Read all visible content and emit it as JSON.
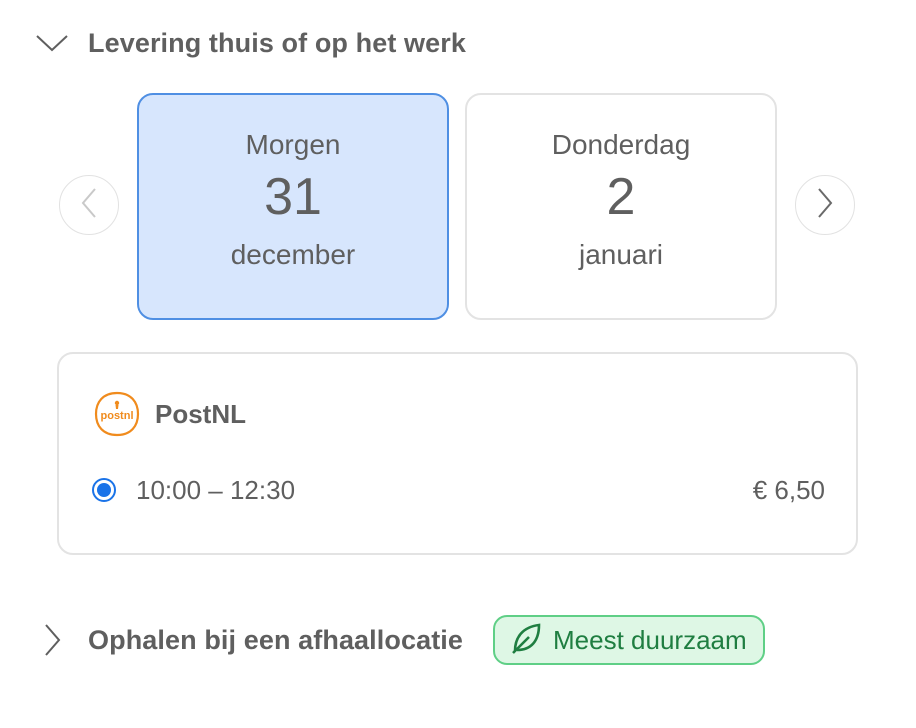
{
  "home_delivery": {
    "title": "Levering thuis of op het werk",
    "expanded": true
  },
  "dates": [
    {
      "day": "Morgen",
      "number": "31",
      "month": "december",
      "selected": true
    },
    {
      "day": "Donderdag",
      "number": "2",
      "month": "januari",
      "selected": false
    }
  ],
  "carrier": {
    "name": "PostNL",
    "logo_text": "postnl",
    "slot": {
      "time": "10:00 – 12:30",
      "price": "€ 6,50",
      "selected": true
    }
  },
  "pickup": {
    "title": "Ophalen bij een afhaallocatie",
    "expanded": false,
    "badge": "Meest duurzaam"
  },
  "icons": {
    "collapse": "chevron-down-icon",
    "expand": "chevron-right-icon",
    "prev": "chevron-left-icon",
    "next": "chevron-right-icon",
    "eco": "leaf-icon",
    "carrier_logo": "postnl-logo"
  },
  "colors": {
    "selected_card_bg": "#d7e6fd",
    "selected_card_border": "#4f8fe3",
    "radio_accent": "#1a73e8",
    "postnl_orange": "#f08b1d",
    "eco_green": "#1f7e41",
    "eco_bg": "#def7e5"
  }
}
